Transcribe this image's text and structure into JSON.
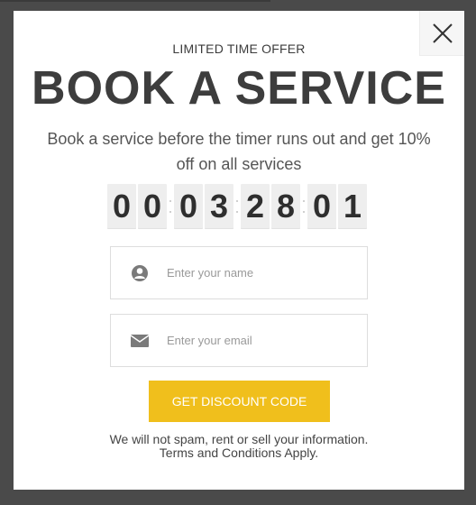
{
  "modal": {
    "eyebrow": "LIMITED TIME OFFER",
    "title": "BOOK A SERVICE",
    "subtitle": "Book a service before the timer runs out and get 10% off on all services",
    "timer_digits": [
      "0",
      "0",
      "0",
      "3",
      "2",
      "8",
      "0",
      "1"
    ],
    "name_field": {
      "placeholder": "Enter your name",
      "icon": "user-icon"
    },
    "email_field": {
      "placeholder": "Enter your email",
      "icon": "envelope-icon"
    },
    "cta_label": "GET DISCOUNT CODE",
    "disclaimer_line1": "We will not spam, rent or sell your information.",
    "disclaimer_line2": "Terms and Conditions Apply."
  },
  "colors": {
    "accent": "#f0bf1c",
    "overlay": "#4a4a4a",
    "text_dark": "#3d3d3d"
  }
}
